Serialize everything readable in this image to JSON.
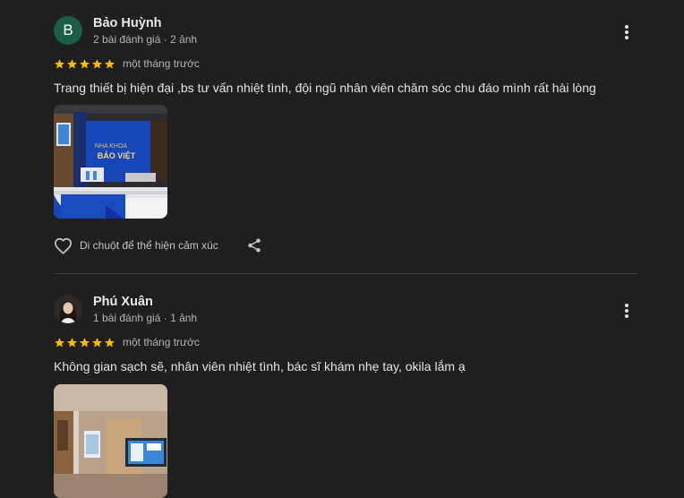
{
  "reviews": [
    {
      "avatar_letter": "B",
      "name": "Bảo Huỳnh",
      "meta": "2 bài đánh giá · 2 ảnh",
      "rating": 5,
      "date": "một tháng trước",
      "text": "Trang thiết bị hiện đại ,bs tư vấn nhiệt tình, đội ngũ nhân viên chăm sóc chu đáo mình rất hài lòng",
      "photo_sign_line1": "NHA KHOA",
      "photo_sign_line2": "BẢO VIỆT",
      "reaction_label": "Di chuột để thể hiện cảm xúc"
    },
    {
      "name": "Phú Xuân",
      "meta": "1 bài đánh giá · 1 ảnh",
      "rating": 5,
      "date": "một tháng trước",
      "text": "Không gian sạch sẽ, nhân viên nhiệt tình, bác sĩ khám nhẹ tay, okila lắm ạ"
    }
  ],
  "colors": {
    "background": "#1f1f1f",
    "star": "#fbbc04",
    "text": "#e3e3e3",
    "secondary_text": "#b4b4b4",
    "avatar_b": "#1a5e4a"
  },
  "icons": [
    "more-vert-icon",
    "star-icon",
    "heart-outline-icon",
    "share-icon"
  ]
}
